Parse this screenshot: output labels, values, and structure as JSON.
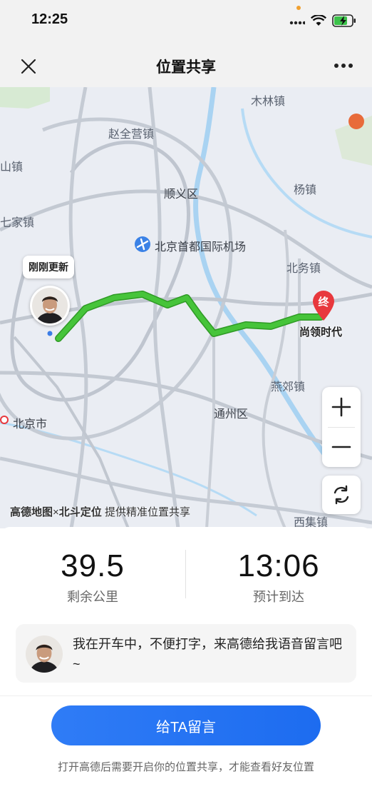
{
  "status_bar": {
    "time": "12:25"
  },
  "nav": {
    "title": "位置共享"
  },
  "map": {
    "places": [
      {
        "name": "木林镇"
      },
      {
        "name": "赵全营镇"
      },
      {
        "name": "山镇"
      },
      {
        "name": "顺义区"
      },
      {
        "name": "杨镇"
      },
      {
        "name": "七家镇"
      },
      {
        "name": "北京首都国际机场"
      },
      {
        "name": "北务镇"
      },
      {
        "name": "燕郊镇"
      },
      {
        "name": "通州区"
      },
      {
        "name": "北京市"
      },
      {
        "name": "西集镇"
      }
    ],
    "avatar_label": "刚刚更新",
    "end_pin_char": "终",
    "destination": "尚领时代",
    "credit_brand1": "高德地图",
    "credit_x": "×",
    "credit_brand2": "北斗定位",
    "credit_rest": " 提供精准位置共享",
    "route_color": "#3dbb2f"
  },
  "stats": {
    "distance_value": "39.5",
    "distance_label": "剩余公里",
    "eta_value": "13:06",
    "eta_label": "预计到达"
  },
  "message": {
    "text": "我在开车中，不便打字，来高德给我语音留言吧~"
  },
  "cta": {
    "label": "给TA留言"
  },
  "note": {
    "text": "打开高德后需要开启你的位置共享，才能查看好友位置"
  },
  "colors": {
    "accent": "#1d6cf0",
    "pin": "#e8383d"
  }
}
